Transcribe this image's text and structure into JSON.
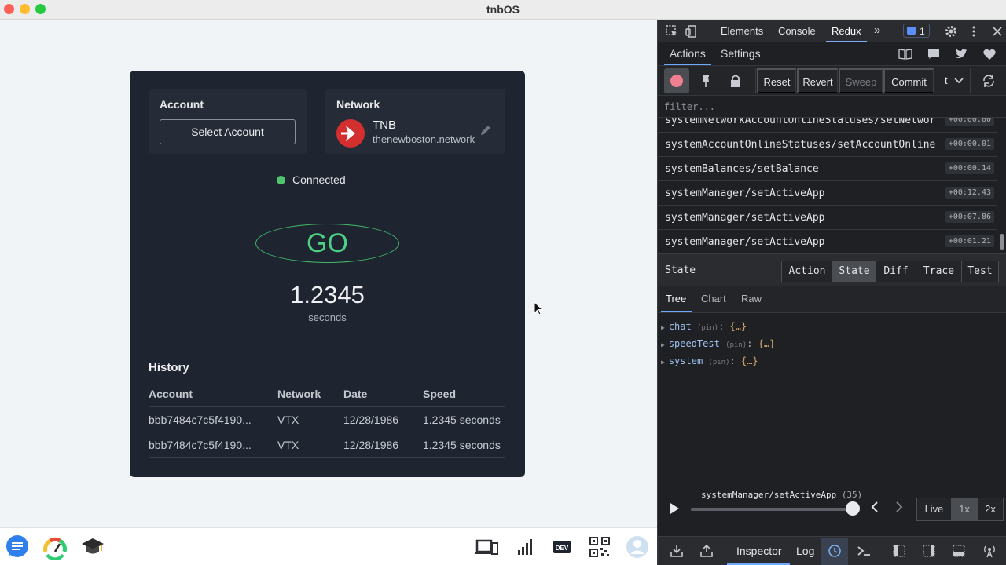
{
  "window": {
    "title": "tnbOS"
  },
  "app": {
    "account": {
      "label": "Account",
      "button": "Select Account"
    },
    "network": {
      "label": "Network",
      "name": "TNB",
      "domain": "thenewboston.network"
    },
    "status": "Connected",
    "go_label": "GO",
    "speed": {
      "value": "1.2345",
      "unit": "seconds"
    },
    "history": {
      "title": "History",
      "columns": [
        "Account",
        "Network",
        "Date",
        "Speed"
      ],
      "rows": [
        [
          "bbb7484c7c5f4190...",
          "VTX",
          "12/28/1986",
          "1.2345 seconds"
        ],
        [
          "bbb7484c7c5f4190...",
          "VTX",
          "12/28/1986",
          "1.2345 seconds"
        ]
      ]
    }
  },
  "dock": {
    "items": [
      "chat-icon",
      "speedometer-icon",
      "graduation-cap-icon"
    ],
    "right_items": [
      "devices-icon",
      "bar-chart-icon",
      "dev-icon",
      "qr-code-icon",
      "user-avatar-icon"
    ],
    "dev_label": "DEV"
  },
  "devtools": {
    "tabs": [
      "Elements",
      "Console",
      "Redux"
    ],
    "active_tab": "Redux",
    "more": "»",
    "badge_count": "1",
    "sub_tabs": [
      "Actions",
      "Settings"
    ],
    "toolbar": [
      "Reset",
      "Revert",
      "Sweep",
      "Commit"
    ],
    "toolbar_extra": "t",
    "filter_placeholder": "filter...",
    "actions": [
      {
        "name": "systemNetworkAccountOnlineStatuses/setNetwork...",
        "time": "+00:00.00"
      },
      {
        "name": "systemAccountOnlineStatuses/setAccountOnlineS...",
        "time": "+00:00.01"
      },
      {
        "name": "systemBalances/setBalance",
        "time": "+00:00.14"
      },
      {
        "name": "systemManager/setActiveApp",
        "time": "+00:12.43"
      },
      {
        "name": "systemManager/setActiveApp",
        "time": "+00:07.86"
      },
      {
        "name": "systemManager/setActiveApp",
        "time": "+00:01.21"
      }
    ],
    "state_title": "State",
    "state_tabs": [
      "Action",
      "State",
      "Diff",
      "Trace",
      "Test"
    ],
    "active_state_tab": "State",
    "view_tabs": [
      "Tree",
      "Chart",
      "Raw"
    ],
    "tree": [
      {
        "key": "chat",
        "pin": "(pin)",
        "value": "{…}"
      },
      {
        "key": "speedTest",
        "pin": "(pin)",
        "value": "{…}"
      },
      {
        "key": "system",
        "pin": "(pin)",
        "value": "{…}"
      }
    ],
    "slider": {
      "action": "systemManager/setActiveApp",
      "count": "(35)",
      "progress": 1.0
    },
    "speed_options": [
      "Live",
      "1x",
      "2x"
    ],
    "active_speed": "1x",
    "bottom_tabs": [
      "Inspector",
      "Log"
    ],
    "colors": {
      "accent": "#6ea8ff",
      "connected": "#4fc46d",
      "go": "#4cd083",
      "logo": "#d32f2f"
    }
  }
}
